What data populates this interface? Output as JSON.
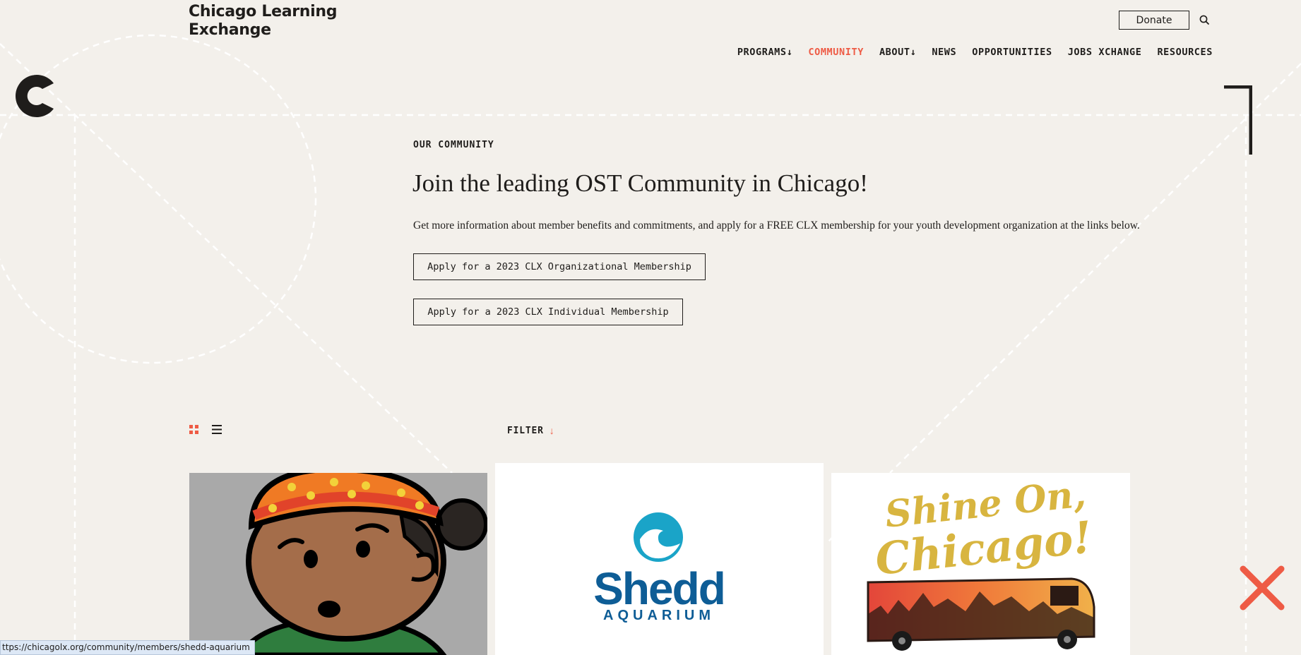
{
  "header": {
    "brand_line1": "Chicago Learning",
    "brand_line2": "Exchange",
    "donate_label": "Donate",
    "search_icon": "search-icon"
  },
  "nav": {
    "items": [
      {
        "label": "PROGRAMS↓",
        "active": false
      },
      {
        "label": "COMMUNITY",
        "active": true
      },
      {
        "label": "ABOUT↓",
        "active": false
      },
      {
        "label": "NEWS",
        "active": false
      },
      {
        "label": "OPPORTUNITIES",
        "active": false
      },
      {
        "label": "JOBS XCHANGE",
        "active": false
      },
      {
        "label": "RESOURCES",
        "active": false
      }
    ]
  },
  "hero": {
    "eyebrow": "OUR COMMUNITY",
    "title": "Join the leading OST Community in Chicago!",
    "description": "Get more information about member benefits and commitments, and apply for a FREE CLX membership for your youth development organization at the links below.",
    "apply_org_label": "Apply for a 2023 CLX Organizational Membership",
    "apply_individual_label": "Apply for a 2023 CLX Individual Membership"
  },
  "controls": {
    "grid_view_icon": "grid-view-icon",
    "list_view_icon": "list-view-icon",
    "filter_label": "FILTER",
    "filter_arrow": "↓"
  },
  "cards": [
    {
      "name": "member-card",
      "image": "cartoon-person-with-beanie"
    },
    {
      "name": "member-card",
      "image": "shedd-aquarium-logo",
      "logo_word": "Shedd",
      "logo_sub": "AQUARIUM"
    },
    {
      "name": "member-card",
      "image": "shine-on-chicago-bus",
      "logo_line1": "Shine On,",
      "logo_line2": "Chicago!"
    }
  ],
  "status_bar": {
    "url": "ttps://chicagolx.org/community/members/shedd-aquarium"
  },
  "colors": {
    "background": "#f3f0eb",
    "text": "#1f1d1b",
    "accent": "#ee5b45",
    "shedd_blue": "#0e5d96",
    "shedd_teal": "#1aa4c8",
    "shine_gold": "#d8b540"
  }
}
